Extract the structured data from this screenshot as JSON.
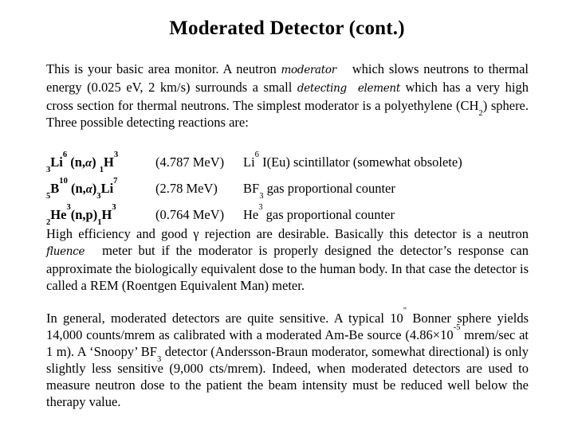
{
  "slide": {
    "title": "Moderated Detector (cont.)",
    "background_color": "#ffffff",
    "text_color": "#000000"
  },
  "paragraphs": {
    "intro": {
      "part1": "This is your basic area monitor.  A neutron ",
      "italic1": "moderator",
      "part2": " which slows neutrons to thermal energy (0.025 eV, 2 km/s) surrounds a small ",
      "italic2": "detecting",
      "italic3": "element",
      "part3": " which has a very high cross section for thermal neutrons. The simplest moderator is a polyethylene (CH",
      "sub_ch2": "2",
      "part4": ") sphere. Three possible detecting reactions are:"
    },
    "rem": {
      "text": "High efficiency and good γ rejection are desirable. Basically this detector is a neutron ",
      "italic1": "fluence",
      "text2": " meter but if the moderator is properly designed the detector’s response can approximate the biologically equivalent dose to the human body. In that case the detector is called a REM   (Roentgen Equivalent Man) meter."
    },
    "general": {
      "part1": "In general, moderated detectors are quite sensitive. A typical 10",
      "sup_inch": "\"",
      "part2": " Bonner sphere yields 14,000 counts/mrem as calibrated with a moderated Am-Be source (4.86×10",
      "sup_exp": "-5",
      "part3": " mrem/sec at 1 m). A ‘Snoopy’ BF",
      "sub_bf3": "3",
      "part4": " detector (Andersson-Braun moderator, somewhat directional) is only slightly less sensitive (9,000 cts/mrem). Indeed, when moderated detectors are used to measure neutron dose to the patient the beam intensity must be reduced well below the therapy value."
    }
  },
  "reactions": [
    {
      "target_z": "3",
      "target_symbol": "Li",
      "target_a": "6",
      "channel_in": "(n,",
      "channel_particle": "α",
      "channel_close": ")",
      "product_z": "1",
      "product_symbol": "H",
      "product_a": "3",
      "energy": "(4.787 MeV)",
      "detector_pre": "Li",
      "detector_sup": "6",
      "detector_post": " I(Eu) scintillator (somewhat obsolete)"
    },
    {
      "target_z": "5",
      "target_symbol": "B",
      "target_a": "10",
      "channel_in": "(n,",
      "channel_particle": "α",
      "channel_close": ")",
      "product_z": "3",
      "product_symbol": "Li",
      "product_a": "7",
      "energy": "(2.78 MeV)",
      "detector_pre": "BF",
      "detector_sub": "3",
      "detector_post": " gas proportional counter"
    },
    {
      "target_z": "2",
      "target_symbol": "He",
      "target_a": "3",
      "channel_in": "(n,",
      "channel_particle": "p",
      "channel_close": ")",
      "product_z": "1",
      "product_symbol": "H",
      "product_a": "3",
      "energy": "(0.764 MeV)",
      "detector_pre": "He",
      "detector_sup": "3",
      "detector_post": " gas proportional counter"
    }
  ]
}
